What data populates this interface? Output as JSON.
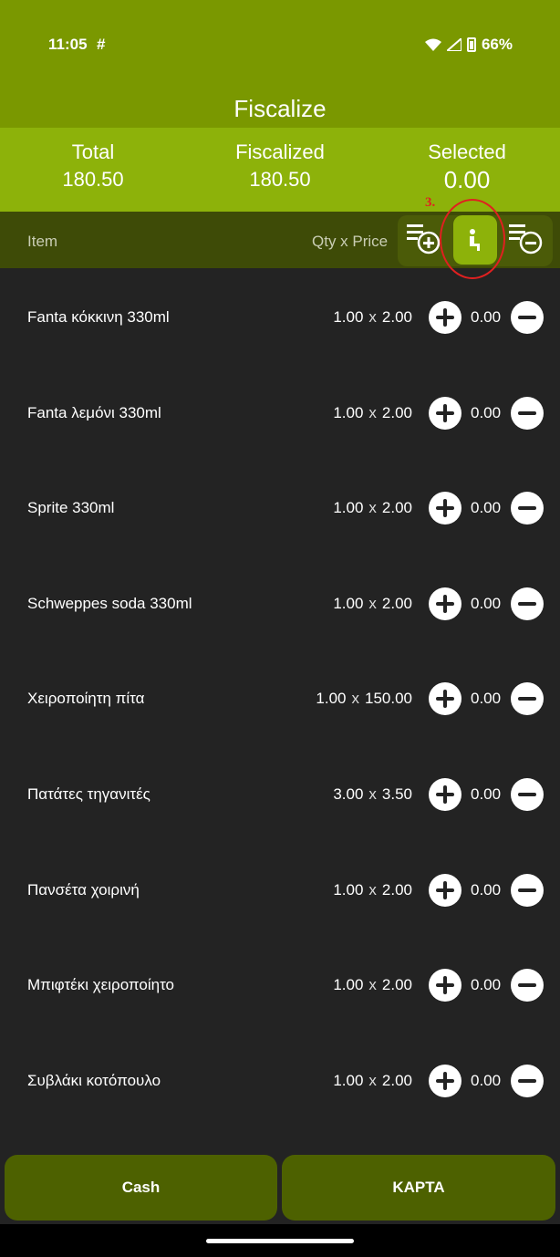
{
  "status_bar": {
    "time": "11:05",
    "slack_glyph": "#",
    "battery": "66%"
  },
  "app": {
    "title": "Fiscalize"
  },
  "summary": {
    "total_label": "Total",
    "total_value": "180.50",
    "fiscalized_label": "Fiscalized",
    "fiscalized_value": "180.50",
    "selected_label": "Selected",
    "selected_value": "0.00"
  },
  "header": {
    "item_label": "Item",
    "qty_price_label": "Qty  x Price"
  },
  "annotation": {
    "label": "3."
  },
  "items": [
    {
      "name": "Fanta κόκκινη 330ml",
      "qty": "1.00",
      "price": "2.00",
      "selected": "0.00"
    },
    {
      "name": "Fanta λεμόνι 330ml",
      "qty": "1.00",
      "price": "2.00",
      "selected": "0.00"
    },
    {
      "name": "Sprite 330ml",
      "qty": "1.00",
      "price": "2.00",
      "selected": "0.00"
    },
    {
      "name": "Schweppes soda 330ml",
      "qty": "1.00",
      "price": "2.00",
      "selected": "0.00"
    },
    {
      "name": "Χειροποίητη πίτα",
      "qty": "1.00",
      "price": "150.00",
      "selected": "0.00"
    },
    {
      "name": "Πατάτες τηγανιτές",
      "qty": "3.00",
      "price": "3.50",
      "selected": "0.00"
    },
    {
      "name": "Πανσέτα χοιρινή",
      "qty": "1.00",
      "price": "2.00",
      "selected": "0.00"
    },
    {
      "name": "Μπιφτέκι χειροποίητο",
      "qty": "1.00",
      "price": "2.00",
      "selected": "0.00"
    },
    {
      "name": "Συβλάκι κοτόπουλο",
      "qty": "1.00",
      "price": "2.00",
      "selected": "0.00"
    }
  ],
  "buttons": {
    "cash": "Cash",
    "card": "ΚΑΡΤΑ"
  },
  "icons": {
    "add_all": "playlist-add-icon",
    "person": "person-seat-icon",
    "remove_all": "playlist-remove-icon"
  },
  "colors": {
    "accent": "#8db20a",
    "dark_green": "#4d6100",
    "background": "#232323"
  }
}
